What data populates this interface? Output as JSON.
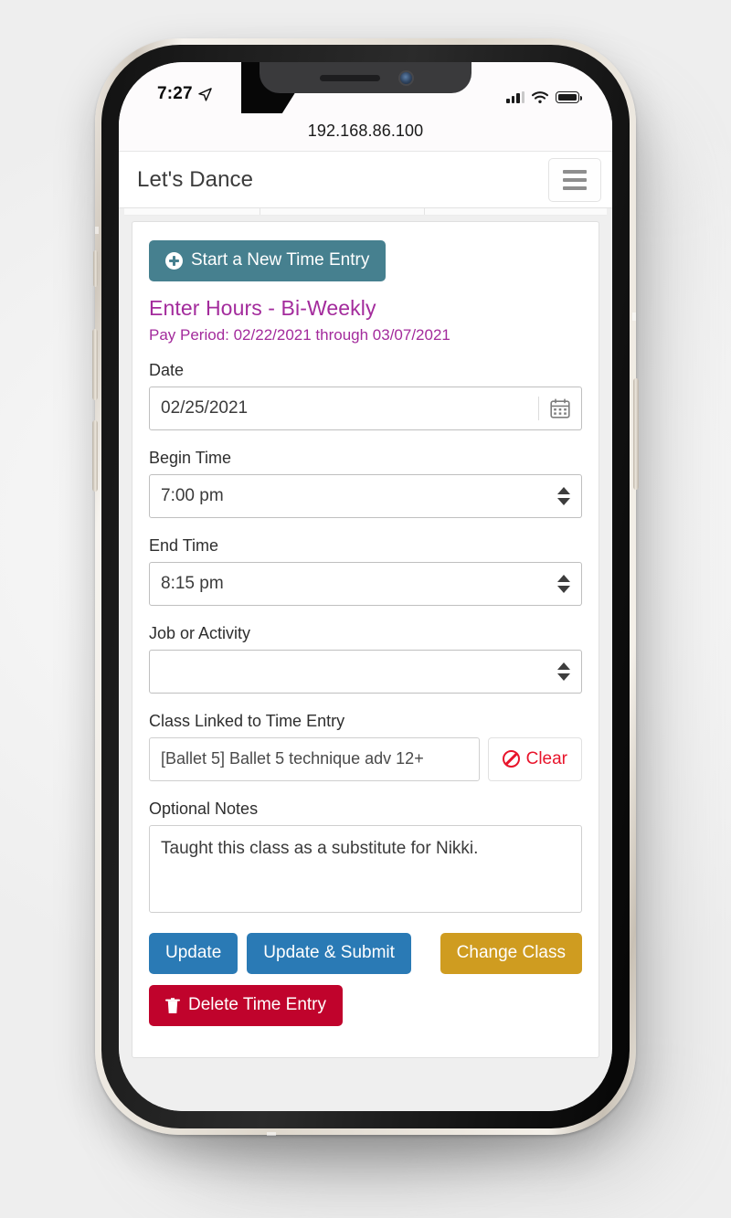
{
  "device": {
    "status_bar": {
      "time": "7:27",
      "location_icon": "location-arrow-icon",
      "signal_icon": "cellular-signal-icon",
      "wifi_icon": "wifi-icon",
      "battery_icon": "battery-icon"
    },
    "home_indicator": "home-indicator"
  },
  "browser": {
    "url": "192.168.86.100",
    "url_prefix": "192",
    "url_rest": ".168.86.100"
  },
  "appbar": {
    "title": "Let's Dance",
    "menu_icon": "hamburger-menu-icon"
  },
  "main": {
    "new_entry_button": "Start a New Time Entry",
    "new_entry_icon": "plus-circle-icon",
    "heading": "Enter Hours - Bi-Weekly",
    "pay_period": "Pay Period: 02/22/2021 through 03/07/2021",
    "fields": {
      "date": {
        "label": "Date",
        "value": "02/25/2021",
        "icon": "calendar-icon"
      },
      "begin_time": {
        "label": "Begin Time",
        "value": "7:00 pm",
        "icon": "stepper-arrows-icon"
      },
      "end_time": {
        "label": "End Time",
        "value": "8:15 pm",
        "icon": "stepper-arrows-icon"
      },
      "job_or_activity": {
        "label": "Job or Activity",
        "value": "",
        "icon": "stepper-arrows-icon"
      },
      "class_linked": {
        "label": "Class Linked to Time Entry",
        "value": "[Ballet 5]  Ballet 5 technique adv 12+",
        "clear_label": "Clear",
        "clear_icon": "ban-icon"
      },
      "optional_notes": {
        "label": "Optional Notes",
        "value": "Taught this class as a substitute for Nikki."
      }
    },
    "actions": {
      "update": "Update",
      "update_submit": "Update & Submit",
      "change_class": "Change Class",
      "delete": "Delete Time Entry",
      "delete_icon": "trash-icon"
    }
  },
  "colors": {
    "teal": "#46808f",
    "blue": "#2a7ab5",
    "gold": "#cf9c20",
    "danger": "#c0032c",
    "purple": "#a32b9c",
    "clear_red": "#e8142b"
  }
}
